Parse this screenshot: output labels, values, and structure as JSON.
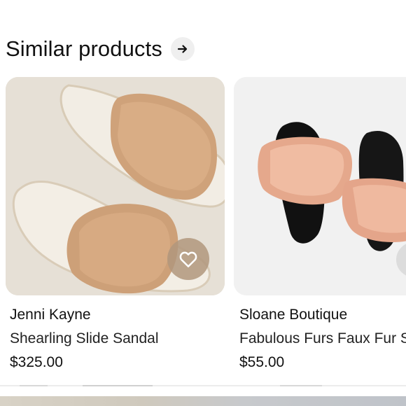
{
  "section": {
    "title": "Similar products",
    "arrow_icon": "arrow-right-icon"
  },
  "products": [
    {
      "brand": "Jenni Kayne",
      "name": "Shearling Slide Sandal",
      "price": "$325.00",
      "save_icon": "heart-outline-icon"
    },
    {
      "brand": "Sloane Boutique",
      "name": "Fabulous Furs Faux Fur Sl",
      "price": "$55.00"
    }
  ],
  "colors": {
    "text": "#111111",
    "card1_bg": "#e8e3da",
    "card2_bg": "#f1f1f1",
    "save_button": "#b0967d",
    "arrow_button": "#efefef"
  }
}
